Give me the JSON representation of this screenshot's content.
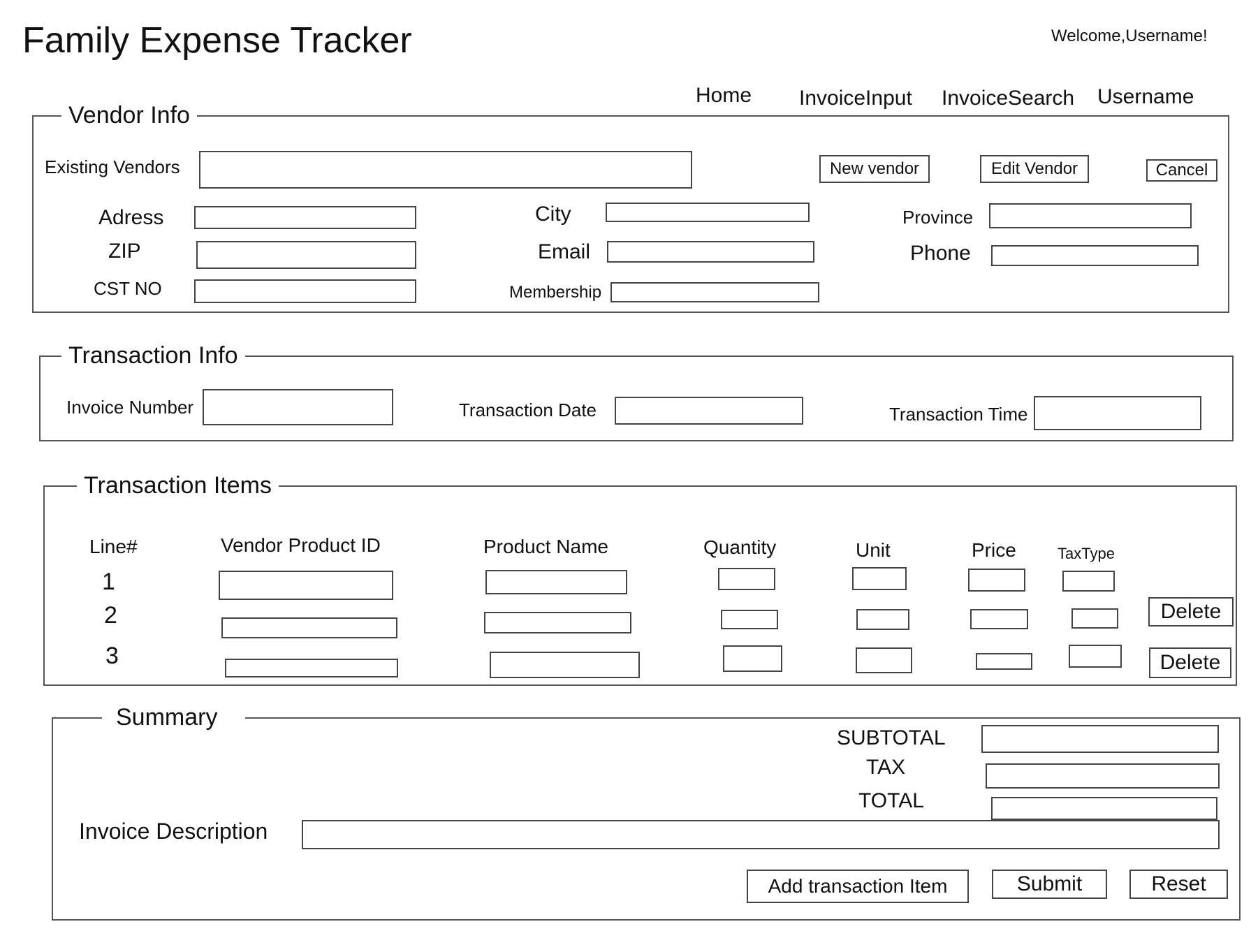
{
  "app": {
    "title": "Family Expense Tracker",
    "welcome": "Welcome,Username!"
  },
  "nav": {
    "items": [
      "Home",
      "InvoiceInput",
      "InvoiceSearch",
      "Username"
    ]
  },
  "vendor_info": {
    "legend": "Vendor Info",
    "existing_vendors_label": "Existing Vendors",
    "existing_vendors_value": "",
    "buttons": {
      "new": "New vendor",
      "edit": "Edit Vendor",
      "cancel": "Cancel"
    },
    "fields": {
      "address_label": "Adress",
      "city_label": "City",
      "province_label": "Province",
      "zip_label": "ZIP",
      "email_label": "Email",
      "phone_label": "Phone",
      "cst_label": "CST NO",
      "membership_label": "Membership"
    }
  },
  "transaction_info": {
    "legend": "Transaction Info",
    "invoice_number_label": "Invoice Number",
    "transaction_date_label": "Transaction Date",
    "transaction_time_label": "Transaction Time"
  },
  "transaction_items": {
    "legend": "Transaction Items",
    "columns": [
      "Line#",
      "Vendor Product ID",
      "Product Name",
      "Quantity",
      "Unit",
      "Price",
      "TaxType"
    ],
    "rows": [
      {
        "line": "1",
        "delete": ""
      },
      {
        "line": "2",
        "delete": "Delete"
      },
      {
        "line": "3",
        "delete": "Delete"
      }
    ]
  },
  "summary": {
    "legend": "Summary",
    "subtotal_label": "SUBTOTAL",
    "tax_label": "TAX",
    "total_label": "TOTAL",
    "description_label": "Invoice Description",
    "buttons": {
      "add": "Add transaction Item",
      "submit": "Submit",
      "reset": "Reset"
    }
  }
}
